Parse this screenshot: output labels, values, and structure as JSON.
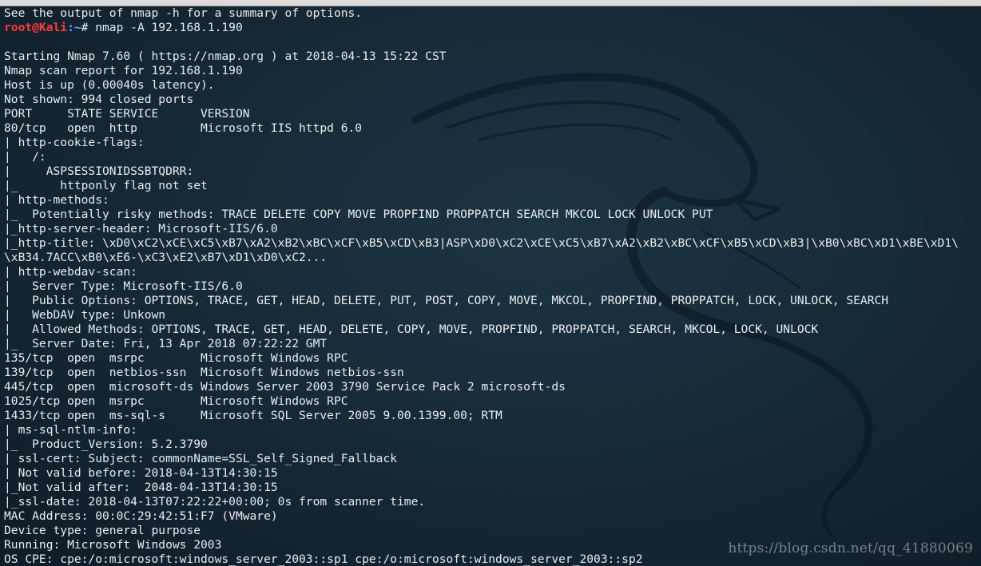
{
  "prompt": {
    "user": "root@Kali",
    "path": ":~",
    "symbol": "# ",
    "command": "nmap -A 192.168.1.190"
  },
  "first_line": "See the output of nmap -h for a summary of options.",
  "output": [
    "",
    "Starting Nmap 7.60 ( https://nmap.org ) at 2018-04-13 15:22 CST",
    "Nmap scan report for 192.168.1.190",
    "Host is up (0.00040s latency).",
    "Not shown: 994 closed ports",
    "PORT     STATE SERVICE      VERSION",
    "80/tcp   open  http         Microsoft IIS httpd 6.0",
    "| http-cookie-flags:",
    "|   /:",
    "|     ASPSESSIONIDSSBTQDRR:",
    "|_      httponly flag not set",
    "| http-methods:",
    "|_  Potentially risky methods: TRACE DELETE COPY MOVE PROPFIND PROPPATCH SEARCH MKCOL LOCK UNLOCK PUT",
    "|_http-server-header: Microsoft-IIS/6.0",
    "|_http-title: \\xD0\\xC2\\xCE\\xC5\\xB7\\xA2\\xB2\\xBC\\xCF\\xB5\\xCD\\xB3|ASP\\xD0\\xC2\\xCE\\xC5\\xB7\\xA2\\xB2\\xBC\\xCF\\xB5\\xCD\\xB3|\\xB0\\xBC\\xD1\\xBE\\xD1\\",
    "\\xB34.7ACC\\xB0\\xE6-\\xC3\\xE2\\xB7\\xD1\\xD0\\xC2...",
    "| http-webdav-scan:",
    "|   Server Type: Microsoft-IIS/6.0",
    "|   Public Options: OPTIONS, TRACE, GET, HEAD, DELETE, PUT, POST, COPY, MOVE, MKCOL, PROPFIND, PROPPATCH, LOCK, UNLOCK, SEARCH",
    "|   WebDAV type: Unkown",
    "|   Allowed Methods: OPTIONS, TRACE, GET, HEAD, DELETE, COPY, MOVE, PROPFIND, PROPPATCH, SEARCH, MKCOL, LOCK, UNLOCK",
    "|_  Server Date: Fri, 13 Apr 2018 07:22:22 GMT",
    "135/tcp  open  msrpc        Microsoft Windows RPC",
    "139/tcp  open  netbios-ssn  Microsoft Windows netbios-ssn",
    "445/tcp  open  microsoft-ds Windows Server 2003 3790 Service Pack 2 microsoft-ds",
    "1025/tcp open  msrpc        Microsoft Windows RPC",
    "1433/tcp open  ms-sql-s     Microsoft SQL Server 2005 9.00.1399.00; RTM",
    "| ms-sql-ntlm-info:",
    "|_  Product_Version: 5.2.3790",
    "| ssl-cert: Subject: commonName=SSL_Self_Signed_Fallback",
    "| Not valid before: 2018-04-13T14:30:15",
    "|_Not valid after:  2048-04-13T14:30:15",
    "|_ssl-date: 2018-04-13T07:22:22+00:00; 0s from scanner time.",
    "MAC Address: 00:0C:29:42:51:F7 (VMware)",
    "Device type: general purpose",
    "Running: Microsoft Windows 2003",
    "OS CPE: cpe:/o:microsoft:windows_server_2003::sp1 cpe:/o:microsoft:windows_server_2003::sp2"
  ],
  "watermark": "https://blog.csdn.net/qq_41880069",
  "colors": {
    "background": "#172a38",
    "text": "#e8ecef",
    "prompt_user": "#ff3b3b",
    "prompt_path": "#6fa8ff"
  }
}
